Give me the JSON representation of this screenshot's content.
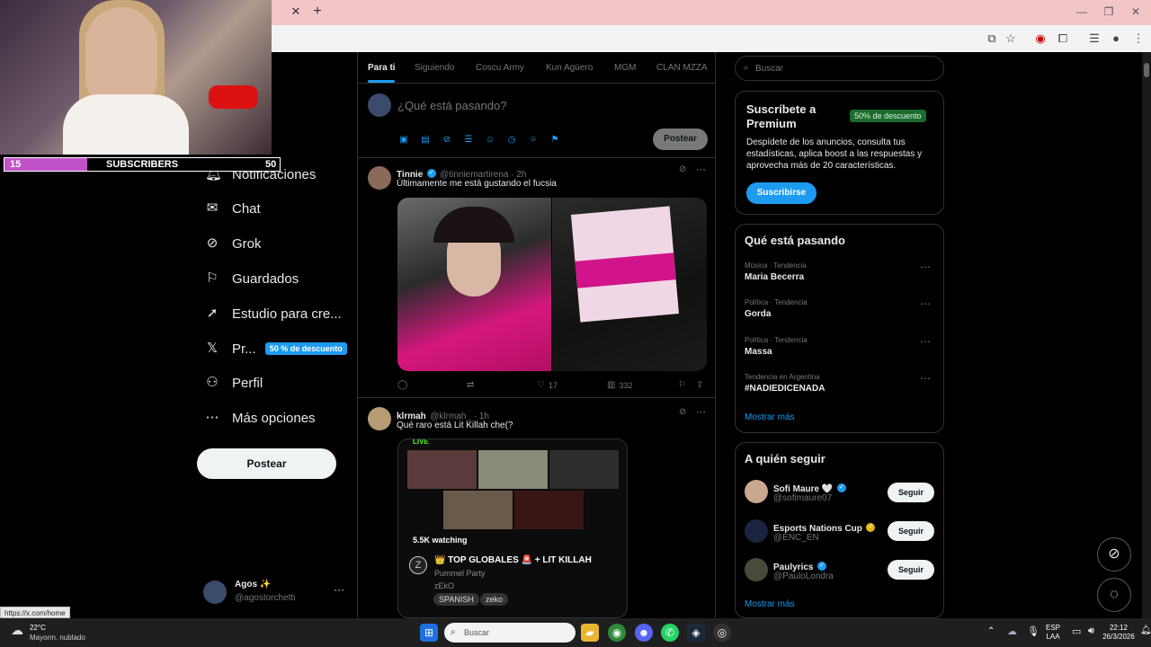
{
  "browser": {
    "close_glyph": "✕",
    "new_tab_glyph": "+",
    "min_glyph": "—",
    "max_glyph": "❐",
    "winclose_glyph": "✕"
  },
  "overlay": {
    "subs_current": "15",
    "subs_label": "SUBSCRIBERS",
    "subs_goal": "50",
    "subs_progress": 0.3
  },
  "sidebar": {
    "items": [
      {
        "label": "Notificaciones",
        "icon": "bell-icon"
      },
      {
        "label": "Chat",
        "icon": "mail-icon"
      },
      {
        "label": "Grok",
        "icon": "grok-icon"
      },
      {
        "label": "Guardados",
        "icon": "bookmark-icon"
      },
      {
        "label": "Estudio para cre...",
        "icon": "rocket-icon"
      },
      {
        "label": "Pr...",
        "icon": "x-logo-icon"
      },
      {
        "label": "Perfil",
        "icon": "person-icon"
      },
      {
        "label": "Más opciones",
        "icon": "more-circle-icon"
      }
    ],
    "premium_badge": "50 % de descuento",
    "post_button": "Postear",
    "account": {
      "name": "Agos ✨",
      "handle": "@agostorchetti",
      "more": "···"
    }
  },
  "timeline": {
    "tabs": [
      "Para ti",
      "Siguiendo",
      "Coscu Army",
      "Kun Agüero",
      "MGM",
      "CLAN MZZA"
    ],
    "composer_placeholder": "¿Qué está pasando?",
    "post_button": "Postear",
    "tweets": [
      {
        "name": "Tinnie",
        "handle": "@tinniemartirena · 2h",
        "text": "Últimamente me está gustando el fucsia",
        "replies": "",
        "reposts": "",
        "likes": "17",
        "views": "332"
      },
      {
        "name": "klrmah",
        "handle": "@klrmah_ · 1h",
        "text": "Qué raro está Lit Killah che(?",
        "embed": {
          "live": "LIVE",
          "watching": "5.5K watching",
          "title": "👑 TOP GLOBALES 🚨 + LIT KILLAH",
          "game": "Pummel Party",
          "channel": "zEkO",
          "tags": [
            "SPANISH",
            "zeko"
          ]
        }
      }
    ]
  },
  "right": {
    "search_placeholder": "Buscar",
    "premium": {
      "title_line1": "Suscríbete a",
      "title_line2": "Premium",
      "badge": "50% de descuento",
      "desc_line1": "Despídete de los anuncios, consulta tus",
      "desc_line2": "estadísticas, aplica boost a las respuestas y",
      "desc_line3": "aprovecha más de 20 características.",
      "button": "Suscribirse"
    },
    "trends": {
      "title": "Qué está pasando",
      "items": [
        {
          "category": "Música · Tendencia",
          "name": "Maria Becerra"
        },
        {
          "category": "Política · Tendencia",
          "name": "Gorda"
        },
        {
          "category": "Política · Tendencia",
          "name": "Massa"
        },
        {
          "category": "Tendencia en Argentina",
          "name": "#NADIEDICENADA"
        }
      ],
      "show_more": "Mostrar más"
    },
    "follow": {
      "title": "A quién seguir",
      "items": [
        {
          "name": "Sofi Maure 🤍",
          "handle": "@sofimaure07",
          "button": "Seguir"
        },
        {
          "name": "Esports Nations Cup",
          "handle": "@ENC_EN",
          "button": "Seguir"
        },
        {
          "name": "Paulyrics",
          "handle": "@PauloLondra",
          "button": "Seguir"
        }
      ],
      "show_more": "Mostrar más"
    }
  },
  "status_url": "https://x.com/home",
  "taskbar": {
    "weather_temp": "22°C",
    "weather_desc": "Mayorm. nublado",
    "search": "Buscar",
    "lang_line1": "ESP",
    "lang_line2": "LAA",
    "time": "22:12",
    "date": "26/3/2026"
  }
}
